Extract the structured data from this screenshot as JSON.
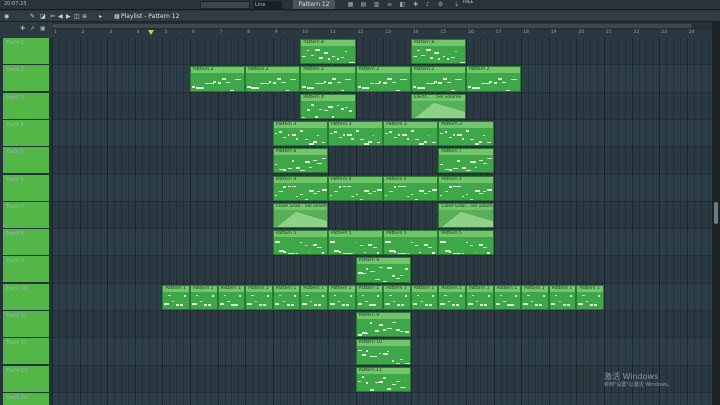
{
  "toolbar": {
    "clock": "20:07:23",
    "pattern": "Pattern 12",
    "line_mode": "Line",
    "news": "FREE"
  },
  "playlist": {
    "title": "Playlist - Pattern 12",
    "arrow": "›"
  },
  "ruler": [
    "1",
    "2",
    "3",
    "4",
    "5",
    "6",
    "7",
    "8",
    "9",
    "10",
    "11",
    "12",
    "13",
    "14",
    "15",
    "16",
    "17",
    "18",
    "19",
    "20",
    "21",
    "22",
    "23",
    "24",
    "25"
  ],
  "tracks": [
    {
      "label": "Track 1"
    },
    {
      "label": "Track 2"
    },
    {
      "label": "Track 3"
    },
    {
      "label": "Track 4"
    },
    {
      "label": "Track 5"
    },
    {
      "label": "Track 6"
    },
    {
      "label": "Track 7"
    },
    {
      "label": "Track 8"
    },
    {
      "label": "Track 9"
    },
    {
      "label": "Track 10"
    },
    {
      "label": "Track 11"
    },
    {
      "label": "Track 12"
    },
    {
      "label": "Track 13"
    },
    {
      "label": "Track 14"
    }
  ],
  "clips": [
    {
      "track": 0,
      "start": 10,
      "len": 2,
      "title": "Pattern 8"
    },
    {
      "track": 0,
      "start": 14,
      "len": 2,
      "title": "Pattern 8"
    },
    {
      "track": 1,
      "start": 6,
      "len": 2,
      "title": "Pattern 2"
    },
    {
      "track": 1,
      "start": 8,
      "len": 2,
      "title": "Pattern 2"
    },
    {
      "track": 1,
      "start": 10,
      "len": 2,
      "title": "Pattern 2"
    },
    {
      "track": 1,
      "start": 12,
      "len": 2,
      "title": "Pattern 2"
    },
    {
      "track": 1,
      "start": 14,
      "len": 2,
      "title": "Pattern 2"
    },
    {
      "track": 1,
      "start": 16,
      "len": 2,
      "title": "Pattern 2"
    },
    {
      "track": 2,
      "start": 10,
      "len": 2,
      "title": "Pattern 4"
    },
    {
      "track": 2,
      "start": 14,
      "len": 2,
      "title": "Electr... ...nel volume",
      "automation": true
    },
    {
      "track": 3,
      "start": 9,
      "len": 2,
      "title": "Pattern 3"
    },
    {
      "track": 3,
      "start": 11,
      "len": 2,
      "title": "Pattern 3"
    },
    {
      "track": 3,
      "start": 13,
      "len": 2,
      "title": "Pattern 3"
    },
    {
      "track": 3,
      "start": 15,
      "len": 2,
      "title": "Pattern 3"
    },
    {
      "track": 4,
      "start": 9,
      "len": 2,
      "title": "Pattern 6"
    },
    {
      "track": 4,
      "start": 15,
      "len": 2,
      "title": "Pattern 7"
    },
    {
      "track": 5,
      "start": 9,
      "len": 2,
      "title": "Pattern 4"
    },
    {
      "track": 5,
      "start": 11,
      "len": 2,
      "title": "Pattern 4"
    },
    {
      "track": 5,
      "start": 13,
      "len": 2,
      "title": "Pattern 4"
    },
    {
      "track": 5,
      "start": 15,
      "len": 2,
      "title": "Pattern 4"
    },
    {
      "track": 6,
      "start": 9,
      "len": 2,
      "title": "Close Gran.. nel volume",
      "automation": true
    },
    {
      "track": 6,
      "start": 15,
      "len": 2,
      "title": "Close Gran.. nel volume",
      "automation": true
    },
    {
      "track": 7,
      "start": 9,
      "len": 2,
      "title": "Pattern 5"
    },
    {
      "track": 7,
      "start": 11,
      "len": 2,
      "title": "Pattern 5"
    },
    {
      "track": 7,
      "start": 13,
      "len": 2,
      "title": "Pattern 5"
    },
    {
      "track": 7,
      "start": 15,
      "len": 2,
      "title": "Pattern 5"
    },
    {
      "track": 8,
      "start": 12,
      "len": 2,
      "title": "Pattern 9"
    },
    {
      "track": 9,
      "start": 5,
      "len": 1,
      "title": "Pattern 1"
    },
    {
      "track": 9,
      "start": 6,
      "len": 1,
      "title": "Pattern 1"
    },
    {
      "track": 9,
      "start": 7,
      "len": 1,
      "title": "Pattern 1"
    },
    {
      "track": 9,
      "start": 8,
      "len": 1,
      "title": "Pattern 1"
    },
    {
      "track": 9,
      "start": 9,
      "len": 1,
      "title": "Pattern 1"
    },
    {
      "track": 9,
      "start": 10,
      "len": 1,
      "title": "Pattern 1"
    },
    {
      "track": 9,
      "start": 11,
      "len": 1,
      "title": "Pattern 1"
    },
    {
      "track": 9,
      "start": 12,
      "len": 1,
      "title": "Pattern 1"
    },
    {
      "track": 9,
      "start": 13,
      "len": 1,
      "title": "Pattern 1"
    },
    {
      "track": 9,
      "start": 14,
      "len": 1,
      "title": "Pattern 1"
    },
    {
      "track": 9,
      "start": 15,
      "len": 1,
      "title": "Pattern 1"
    },
    {
      "track": 9,
      "start": 16,
      "len": 1,
      "title": "Pattern 1"
    },
    {
      "track": 9,
      "start": 17,
      "len": 1,
      "title": "Pattern 1"
    },
    {
      "track": 9,
      "start": 18,
      "len": 1,
      "title": "Pattern 1"
    },
    {
      "track": 9,
      "start": 19,
      "len": 1,
      "title": "Pattern 1"
    },
    {
      "track": 9,
      "start": 20,
      "len": 1,
      "title": "Pattern 1"
    },
    {
      "track": 10,
      "start": 12,
      "len": 2,
      "title": "Pattern 9"
    },
    {
      "track": 11,
      "start": 12,
      "len": 2,
      "title": "Pattern 10"
    },
    {
      "track": 12,
      "start": 12,
      "len": 2,
      "title": "Pattern 11"
    }
  ],
  "watermark": {
    "title": "激活 Windows",
    "subtitle": "转到\"设置\"以激活 Windows。"
  },
  "colors": {
    "clip": "#3ea748",
    "clip_header": "#73c56c",
    "mute_bar": "#53b747",
    "grid": "#2a3942"
  }
}
